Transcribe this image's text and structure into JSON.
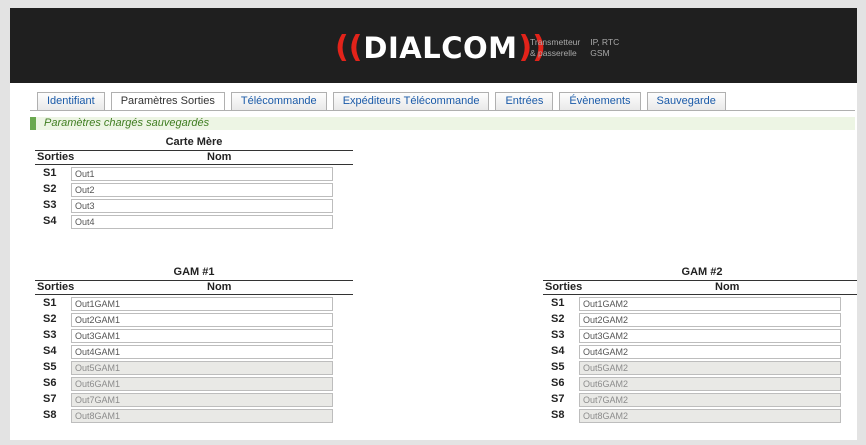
{
  "header": {
    "brand_paren_left": "((",
    "brand_name": "DIALCOM",
    "brand_paren_right": "))",
    "tagline": [
      "Transmetteur",
      "IP, RTC",
      "& passerelle",
      "GSM"
    ],
    "accent": "#e2231a"
  },
  "tabs": [
    {
      "label": "Identifiant",
      "active": false
    },
    {
      "label": "Paramètres Sorties",
      "active": true
    },
    {
      "label": "Télécommande",
      "active": false
    },
    {
      "label": "Expéditeurs Télécommande",
      "active": false
    },
    {
      "label": "Entrées",
      "active": false
    },
    {
      "label": "Évènements",
      "active": false
    },
    {
      "label": "Sauvegarde",
      "active": false
    }
  ],
  "status": {
    "message": "Paramètres chargés sauvegardés",
    "color": "#6aa84f"
  },
  "carte_mere": {
    "title": "Carte Mère",
    "col_sorties": "Sorties",
    "col_nom": "Nom",
    "rows": [
      {
        "id": "S1",
        "value": "Out1",
        "enabled": true
      },
      {
        "id": "S2",
        "value": "Out2",
        "enabled": true
      },
      {
        "id": "S3",
        "value": "Out3",
        "enabled": true
      },
      {
        "id": "S4",
        "value": "Out4",
        "enabled": true
      }
    ]
  },
  "gam1": {
    "title": "GAM #1",
    "col_sorties": "Sorties",
    "col_nom": "Nom",
    "rows": [
      {
        "id": "S1",
        "value": "Out1GAM1",
        "enabled": true
      },
      {
        "id": "S2",
        "value": "Out2GAM1",
        "enabled": true
      },
      {
        "id": "S3",
        "value": "Out3GAM1",
        "enabled": true
      },
      {
        "id": "S4",
        "value": "Out4GAM1",
        "enabled": true
      },
      {
        "id": "S5",
        "value": "Out5GAM1",
        "enabled": false
      },
      {
        "id": "S6",
        "value": "Out6GAM1",
        "enabled": false
      },
      {
        "id": "S7",
        "value": "Out7GAM1",
        "enabled": false
      },
      {
        "id": "S8",
        "value": "Out8GAM1",
        "enabled": false
      }
    ]
  },
  "gam2": {
    "title": "GAM #2",
    "col_sorties": "Sorties",
    "col_nom": "Nom",
    "rows": [
      {
        "id": "S1",
        "value": "Out1GAM2",
        "enabled": true
      },
      {
        "id": "S2",
        "value": "Out2GAM2",
        "enabled": true
      },
      {
        "id": "S3",
        "value": "Out3GAM2",
        "enabled": true
      },
      {
        "id": "S4",
        "value": "Out4GAM2",
        "enabled": true
      },
      {
        "id": "S5",
        "value": "Out5GAM2",
        "enabled": false
      },
      {
        "id": "S6",
        "value": "Out6GAM2",
        "enabled": false
      },
      {
        "id": "S7",
        "value": "Out7GAM2",
        "enabled": false
      },
      {
        "id": "S8",
        "value": "Out8GAM2",
        "enabled": false
      }
    ]
  }
}
